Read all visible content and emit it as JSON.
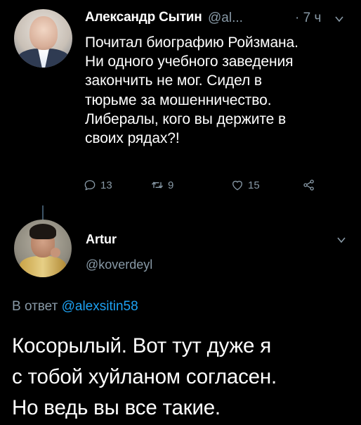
{
  "tweet": {
    "author": {
      "name": "Александр Сытин",
      "handle": "@al...",
      "time": "· 7 ч"
    },
    "text_lines": [
      "Почитал биографию Ройзмана.",
      "Ни одного учебного заведения",
      "закончить не мог. Сидел в",
      "тюрьме за мошенничество.",
      "Либералы, кого вы держите в",
      "своих рядах?!"
    ],
    "actions": {
      "replies": "13",
      "retweets": "9",
      "likes": "15"
    }
  },
  "reply": {
    "author": {
      "name": "Artur",
      "handle": "@koverdeyl"
    },
    "replying_prefix": "В ответ",
    "replying_to": "@alexsitin58",
    "text_lines": [
      "Косорылый. Вот тут дуже я",
      "с тобой хуйланом согласен.",
      "Но ведь вы все такие."
    ]
  },
  "colors": {
    "background": "#000000",
    "text": "#ffffff",
    "secondary": "#8899a6",
    "accent": "#1da1f2",
    "thread_line": "#3d5466"
  },
  "icons": [
    "reply-icon",
    "retweet-icon",
    "like-icon",
    "share-icon",
    "chevron-down-icon"
  ]
}
